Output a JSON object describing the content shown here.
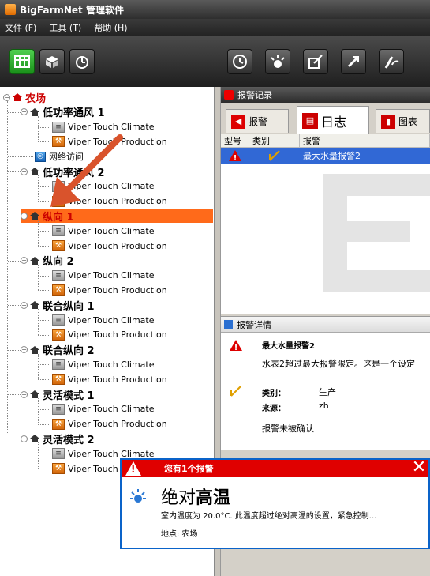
{
  "window": {
    "title": "BigFarmNet 管理软件"
  },
  "menu": [
    "文件 (F)",
    "工具 (T)",
    "帮助 (H)"
  ],
  "toolbar_left": [
    {
      "icon": "grid-icon"
    },
    {
      "icon": "box-icon"
    },
    {
      "icon": "timer-icon"
    }
  ],
  "toolbar_right": [
    {
      "icon": "clock-icon"
    },
    {
      "icon": "sun-icon"
    },
    {
      "icon": "edit-icon"
    },
    {
      "icon": "tool-icon"
    },
    {
      "icon": "gauge-icon"
    }
  ],
  "tree": {
    "root": "农场",
    "network": "网络访问",
    "groups": [
      {
        "name": "低功率通风 1",
        "devices": [
          "Viper Touch Climate",
          "Viper Touch Production"
        ]
      },
      {
        "name": "低功率通风 2",
        "devices": [
          "Viper Touch Climate",
          "Viper Touch Production"
        ]
      },
      {
        "name": "纵向 1",
        "devices": [
          "Viper Touch Climate",
          "Viper Touch Production"
        ]
      },
      {
        "name": "纵向 2",
        "devices": [
          "Viper Touch Climate",
          "Viper Touch Production"
        ]
      },
      {
        "name": "联合纵向 1",
        "devices": [
          "Viper Touch Climate",
          "Viper Touch Production"
        ]
      },
      {
        "name": "联合纵向 2",
        "devices": [
          "Viper Touch Climate",
          "Viper Touch Production"
        ]
      },
      {
        "name": "灵活模式 1",
        "devices": [
          "Viper Touch Climate",
          "Viper Touch Production"
        ]
      },
      {
        "name": "灵活模式 2",
        "devices": [
          "Viper Touch Climate",
          "Viper Touch"
        ]
      }
    ]
  },
  "alarm_panel": {
    "title": "报警记录",
    "tabs": [
      "报警",
      "日志",
      "图表"
    ],
    "columns": [
      "型号",
      "类别",
      "报警"
    ],
    "rows": [
      {
        "alarm": "最大水量报警2"
      }
    ]
  },
  "details": {
    "title": "报警详情",
    "heading": "最大水量报警2",
    "text": "水表2超过最大报警限定。这是一个设定",
    "category_label": "类别：",
    "category_value": "生产",
    "source_label": "来源：",
    "source_value": "zh",
    "status": "报警未被确认"
  },
  "popup": {
    "header": "您有1个报警",
    "title_prefix": "绝对",
    "title_bold": "高温",
    "desc": "室内温度为 20.0°C. 此温度超过绝对高温的设置，紧急控制...",
    "location": "地点: 农场"
  },
  "colors": {
    "selected": "#ff6a1a",
    "alarm_red": "#e00000",
    "accent_blue": "#3168d5"
  }
}
